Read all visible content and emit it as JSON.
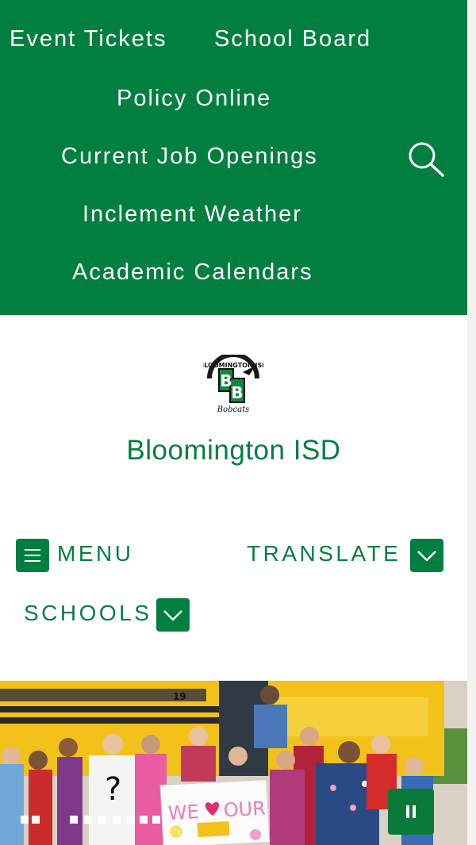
{
  "top_nav": {
    "links": [
      "Event Tickets",
      "School Board",
      "Policy Online",
      "Current Job Openings",
      "Inclement Weather",
      "Academic Calendars"
    ],
    "search_icon": "search-icon"
  },
  "header": {
    "logo_text": "BLOOMINGTON ISD",
    "logo_script": "Bobcats",
    "title": "Bloomington ISD"
  },
  "controls": {
    "menu_label": "MENU",
    "menu_icon": "hamburger-icon",
    "translate_label": "TRANSLATE",
    "schools_label": "SCHOOLS",
    "dropdown_icon": "chevron-down-icon"
  },
  "hero": {
    "sign_text": "WE",
    "sign_text2": "OUR",
    "bus_number": "19",
    "pause_icon": "pause-icon",
    "slide_count": 8
  },
  "colors": {
    "brand_green": "#007f40",
    "white": "#ffffff",
    "bus_yellow": "#f2c21b"
  }
}
